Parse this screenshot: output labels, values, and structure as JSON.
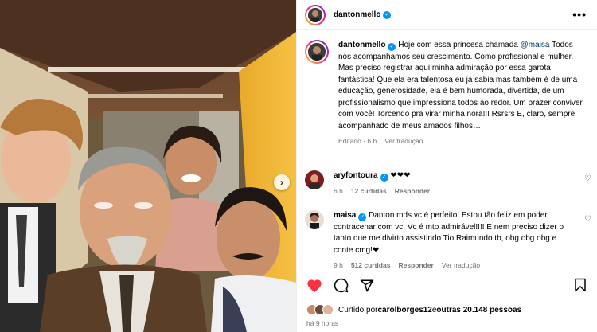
{
  "post": {
    "username": "dantonmello",
    "more_label": "•••"
  },
  "caption": {
    "username": "dantonmello",
    "text_before": "Hoje com essa princesa chamada ",
    "mention": "@maisa",
    "text_after": " Todos nós acompanhamos seu crescimento. Como profissional e mulher. Mas preciso registrar aqui minha admiração por essa garota fantástica! Que ela era talentosa eu já sabia mas também é de uma educação, generosidade, ela é bem humorada, divertida, de um profissionalismo que impressiona todos ao redor. Um prazer conviver com você! Torcendo pra virar minha nora!!! Rsrsrs E, claro, sempre acompanhado de meus amados filhos…",
    "edited": "Editado · 6 h",
    "see_translation": "Ver tradução"
  },
  "comments": [
    {
      "username": "aryfontoura",
      "text": "❤❤❤",
      "time": "6 h",
      "likes": "12 curtidas",
      "reply": "Responder",
      "translation": ""
    },
    {
      "username": "maisa",
      "text": "Danton mds vc é perfeito! Estou tão feliz em poder contracenar com vc. Vc é mto admirável!!!! E nem preciso dizer o tanto que me divirto assistindo Tio Raimundo tb, obg obg obg e conte cmg!❤",
      "time": "9 h",
      "likes": "512 curtidas",
      "reply": "Responder",
      "translation": "Ver tradução"
    }
  ],
  "likes_summary": {
    "prefix": "Curtido por ",
    "user": "carolborges12",
    "middle": " e ",
    "others": "outras 20.148 pessoas"
  },
  "posted_ago": "há 9 horas",
  "icons": {
    "like": "heart-icon",
    "comment": "comment-icon",
    "share": "share-icon",
    "save": "bookmark-icon",
    "next": "chevron-right-icon"
  },
  "colors": {
    "like_red": "#ff3040",
    "link_blue": "#00376b",
    "verified_blue": "#0095f6",
    "meta_gray": "#737373"
  }
}
